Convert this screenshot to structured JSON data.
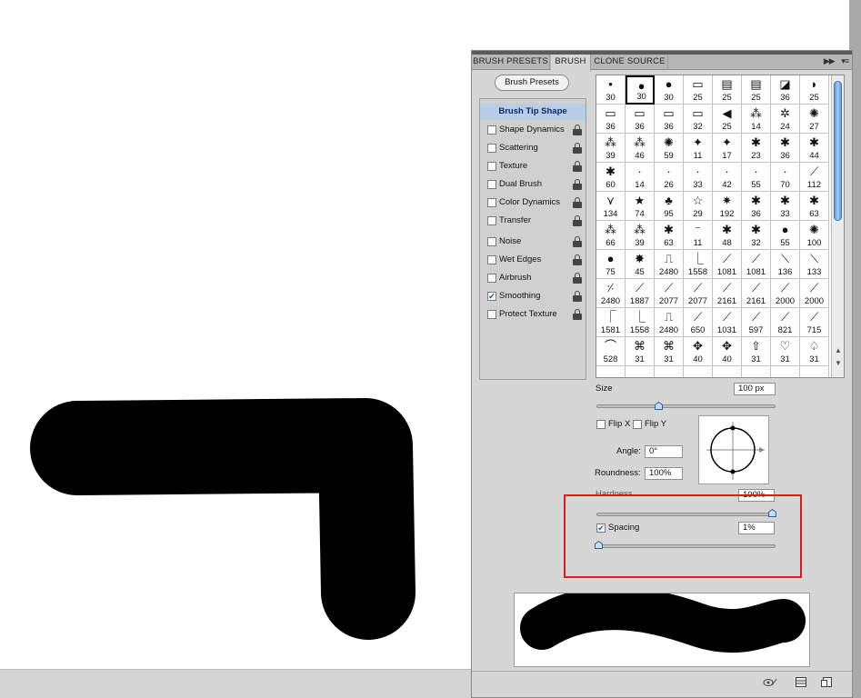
{
  "panel": {
    "tabs": [
      {
        "label": "BRUSH PRESETS",
        "active": false
      },
      {
        "label": "BRUSH",
        "active": true
      },
      {
        "label": "CLONE SOURCE",
        "active": false
      }
    ],
    "presets_button": "Brush Presets",
    "side_items": [
      {
        "label": "Brush Tip Shape",
        "checkbox": false,
        "checked": false,
        "lock": false,
        "selected": true
      },
      {
        "label": "Shape Dynamics",
        "checkbox": true,
        "checked": false,
        "lock": true
      },
      {
        "label": "Scattering",
        "checkbox": true,
        "checked": false,
        "lock": true
      },
      {
        "label": "Texture",
        "checkbox": true,
        "checked": false,
        "lock": true
      },
      {
        "label": "Dual Brush",
        "checkbox": true,
        "checked": false,
        "lock": true
      },
      {
        "label": "Color Dynamics",
        "checkbox": true,
        "checked": false,
        "lock": true
      },
      {
        "label": "Transfer",
        "checkbox": true,
        "checked": false,
        "lock": true
      },
      {
        "label": "Noise",
        "checkbox": true,
        "checked": false,
        "lock": true
      },
      {
        "label": "Wet Edges",
        "checkbox": true,
        "checked": false,
        "lock": true
      },
      {
        "label": "Airbrush",
        "checkbox": true,
        "checked": false,
        "lock": true
      },
      {
        "label": "Smoothing",
        "checkbox": true,
        "checked": true,
        "lock": true
      },
      {
        "label": "Protect Texture",
        "checkbox": true,
        "checked": false,
        "lock": true
      }
    ],
    "brush_tips": [
      "30",
      "30",
      "30",
      "25",
      "25",
      "25",
      "36",
      "25",
      "36",
      "36",
      "36",
      "32",
      "25",
      "14",
      "24",
      "27",
      "39",
      "46",
      "59",
      "11",
      "17",
      "23",
      "36",
      "44",
      "60",
      "14",
      "26",
      "33",
      "42",
      "55",
      "70",
      "112",
      "134",
      "74",
      "95",
      "29",
      "192",
      "36",
      "33",
      "63",
      "66",
      "39",
      "63",
      "11",
      "48",
      "32",
      "55",
      "100",
      "75",
      "45",
      "2480",
      "1558",
      "1081",
      "1081",
      "136",
      "133",
      "2480",
      "1887",
      "2077",
      "2077",
      "2161",
      "2161",
      "2000",
      "2000",
      "1581",
      "1558",
      "2480",
      "650",
      "1031",
      "597",
      "821",
      "715",
      "528",
      "31",
      "31",
      "40",
      "40",
      "31",
      "31",
      "31"
    ],
    "brush_glyphs": [
      "•",
      "●",
      "●",
      "▭",
      "▤",
      "▤",
      "◪",
      "◗",
      "▭",
      "▭",
      "▭",
      "▭",
      "◀",
      "⁂",
      "✲",
      "✺",
      "⁂",
      "⁂",
      "✺",
      "✦",
      "✦",
      "✱",
      "✱",
      "✱",
      "✱",
      "·",
      "·",
      "·",
      "·",
      "·",
      "·",
      "⟋",
      "⋎",
      "★",
      "♣",
      "☆",
      "✷",
      "✱",
      "✱",
      "✱",
      "⁂",
      "⁂",
      "✱",
      "⁻",
      "✱",
      "✱",
      "●",
      "✺",
      "●",
      "✸",
      "⎍",
      "⎿",
      "⟋",
      "⟋",
      "⟍",
      "⟍",
      "⸓",
      "⟋",
      "⟋",
      "⟋",
      "⟋",
      "⟋",
      "⟋",
      "⟋",
      "⎾",
      "⎿",
      "⎍",
      "⟋",
      "⟋",
      "⟋",
      "⟋",
      "⟋",
      "⌒",
      "⌘",
      "⌘",
      "✥",
      "✥",
      "⇧",
      "♡",
      "♤"
    ],
    "selected_tip_index": 1,
    "size": {
      "label": "Size",
      "value": "100 px"
    },
    "flip_x": {
      "label": "Flip X",
      "checked": false
    },
    "flip_y": {
      "label": "Flip Y",
      "checked": false
    },
    "angle": {
      "label": "Angle:",
      "value": "0°"
    },
    "roundness": {
      "label": "Roundness:",
      "value": "100%"
    },
    "hardness": {
      "label": "Hardness",
      "value": "100%"
    },
    "spacing": {
      "label": "Spacing",
      "value": "1%",
      "checked": true
    },
    "slider_levels": {
      "size": 0.35,
      "hardness": 1.0,
      "spacing": 0.01
    },
    "colors": {
      "panel_bg": "#d6d6d6",
      "tab_bg": "#b7b7b7",
      "selected_item": "#b9cde6",
      "highlight": "#e01818",
      "scroll_thumb": "#5d97d8"
    }
  }
}
